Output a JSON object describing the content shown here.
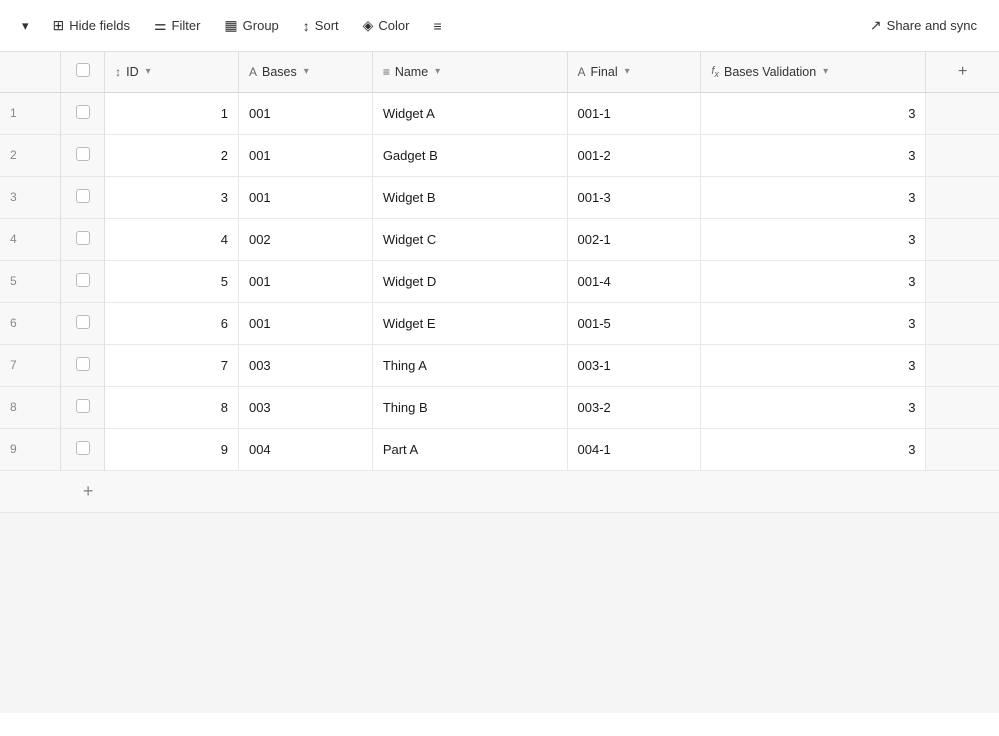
{
  "toolbar": {
    "chevron_label": "▾",
    "hide_fields_label": "Hide fields",
    "filter_label": "Filter",
    "group_label": "Group",
    "sort_label": "Sort",
    "color_label": "Color",
    "row_height_label": "≡",
    "share_sync_label": "Share and sync"
  },
  "table": {
    "columns": [
      {
        "id": "col-id",
        "icon": "↕",
        "label": "ID",
        "type": "id"
      },
      {
        "id": "col-bases",
        "icon": "A",
        "label": "Bases",
        "type": "text"
      },
      {
        "id": "col-name",
        "icon": "≡",
        "label": "Name",
        "type": "text"
      },
      {
        "id": "col-final",
        "icon": "A",
        "label": "Final",
        "type": "text"
      },
      {
        "id": "col-bases-val",
        "icon": "fx",
        "label": "Bases Validation",
        "type": "formula"
      }
    ],
    "rows": [
      {
        "row_num": "1",
        "id": 1,
        "bases": "001",
        "name": "Widget A",
        "final": "001-1",
        "bases_val": 3
      },
      {
        "row_num": "2",
        "id": 2,
        "bases": "001",
        "name": "Gadget B",
        "final": "001-2",
        "bases_val": 3
      },
      {
        "row_num": "3",
        "id": 3,
        "bases": "001",
        "name": "Widget B",
        "final": "001-3",
        "bases_val": 3
      },
      {
        "row_num": "4",
        "id": 4,
        "bases": "002",
        "name": "Widget C",
        "final": "002-1",
        "bases_val": 3
      },
      {
        "row_num": "5",
        "id": 5,
        "bases": "001",
        "name": "Widget D",
        "final": "001-4",
        "bases_val": 3
      },
      {
        "row_num": "6",
        "id": 6,
        "bases": "001",
        "name": "Widget E",
        "final": "001-5",
        "bases_val": 3
      },
      {
        "row_num": "7",
        "id": 7,
        "bases": "003",
        "name": "Thing A",
        "final": "003-1",
        "bases_val": 3
      },
      {
        "row_num": "8",
        "id": 8,
        "bases": "003",
        "name": "Thing B",
        "final": "003-2",
        "bases_val": 3
      },
      {
        "row_num": "9",
        "id": 9,
        "bases": "004",
        "name": "Part A",
        "final": "004-1",
        "bases_val": 3
      }
    ],
    "add_column_label": "+",
    "add_row_label": "+"
  }
}
